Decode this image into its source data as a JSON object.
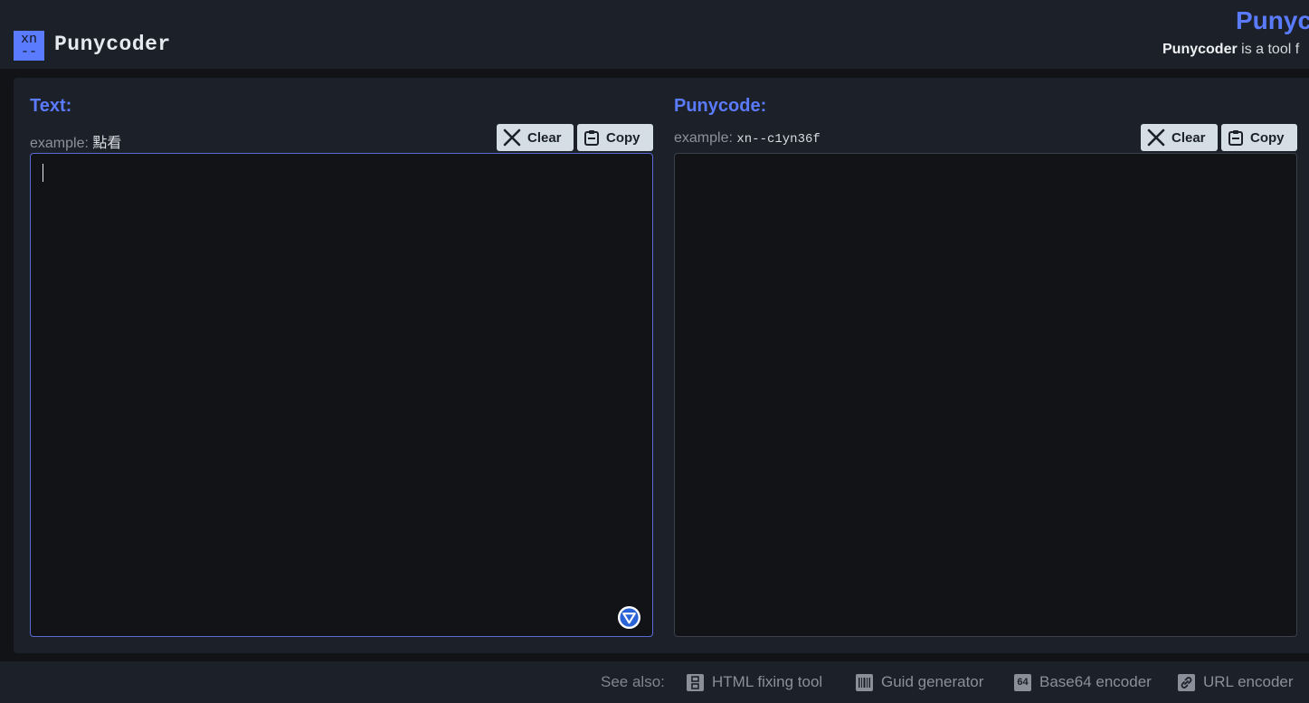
{
  "header": {
    "logo_top": "xn",
    "logo_bottom": "--",
    "app_name": "Punycoder",
    "title": "Punyc",
    "tagline_bold": "Punycoder",
    "tagline_rest": " is a tool f"
  },
  "text_panel": {
    "label": "Text:",
    "example_prefix": "example: ",
    "example_value": "點看",
    "clear_label": "Clear",
    "copy_label": "Copy",
    "value": ""
  },
  "punycode_panel": {
    "label": "Punycode:",
    "example_prefix": "example: ",
    "example_value": "xn--c1yn36f",
    "clear_label": "Clear",
    "copy_label": "Copy",
    "value": ""
  },
  "footer": {
    "see_also": "See also:",
    "links": [
      {
        "label": "HTML fixing tool",
        "icon": "html-tool-icon"
      },
      {
        "label": "Guid generator",
        "icon": "barcode-icon"
      },
      {
        "label": "Base64 encoder",
        "icon": "base64-icon",
        "icon_text": "64"
      },
      {
        "label": "URL encoder",
        "icon": "link-icon"
      }
    ]
  },
  "colors": {
    "accent": "#5b7bff",
    "background": "#111317",
    "panel": "#1c2028",
    "button": "#d5dde5"
  }
}
